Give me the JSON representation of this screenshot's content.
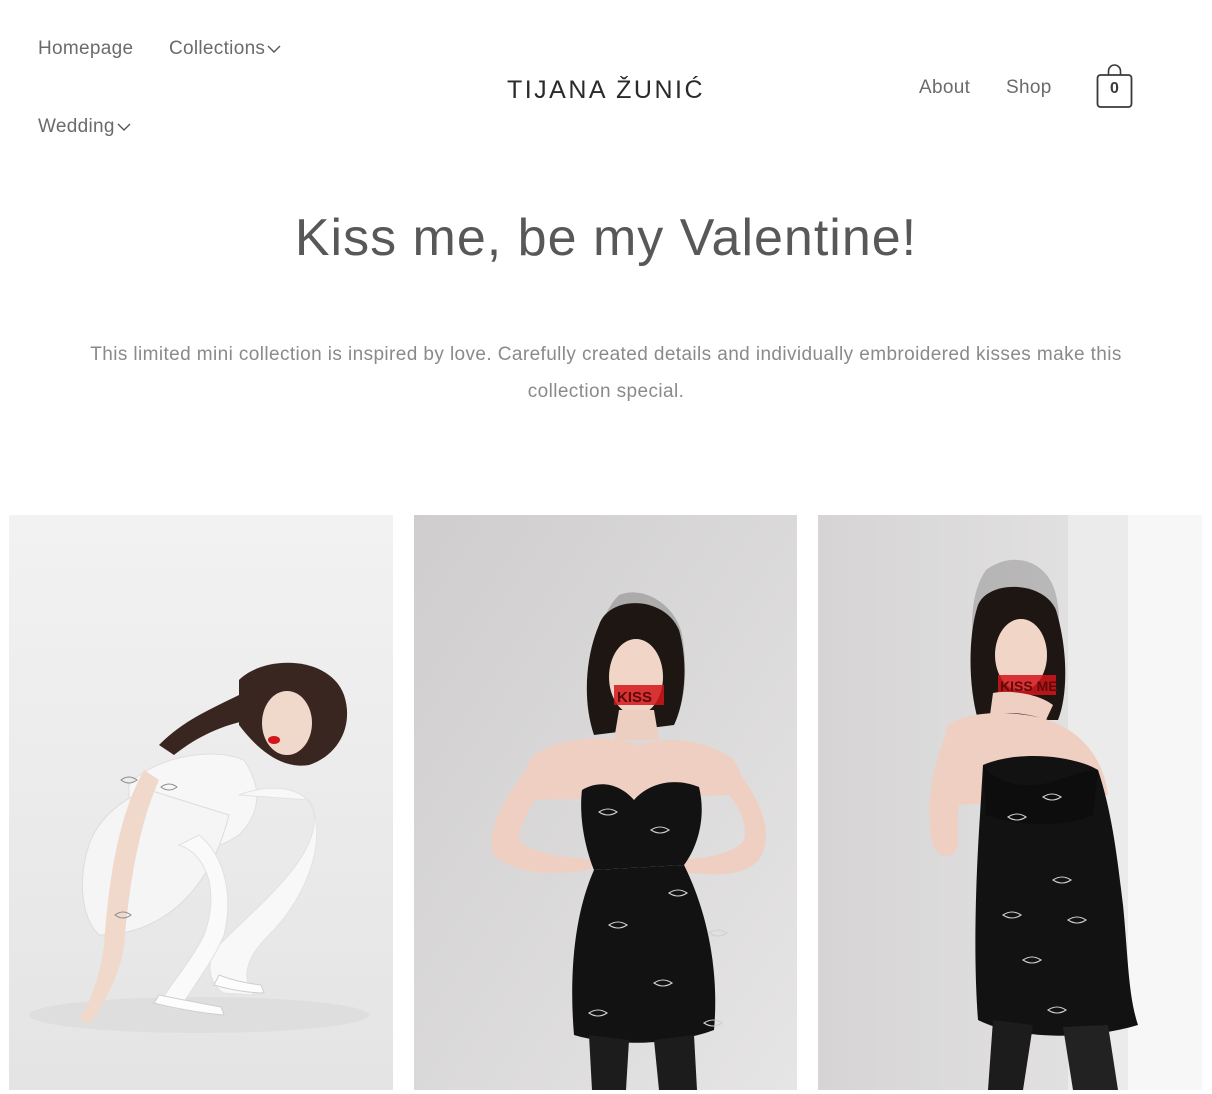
{
  "nav": {
    "homepage": "Homepage",
    "collections": "Collections",
    "wedding": "Wedding",
    "about": "About",
    "shop": "Shop"
  },
  "logo": "TIJANA ŽUNIĆ",
  "cart": {
    "count": "0"
  },
  "page": {
    "title": "Kiss me, be my Valentine!",
    "intro": "This limited mini collection is inspired by love. Carefully created details and individually embroidered kisses make this collection special."
  },
  "gallery": {
    "photos": [
      {
        "dress": "white strapless mini dress with embroidered kisses"
      },
      {
        "dress": "black strapless mini dress with embroidered kisses",
        "mask_text": "KISS"
      },
      {
        "dress": "black strapless mini dress with embroidered kisses",
        "mask_text": "KISS ME"
      }
    ]
  },
  "colors": {
    "text": "#6b6b6b",
    "accent_red": "#d4151a",
    "dress_black": "#121212"
  }
}
